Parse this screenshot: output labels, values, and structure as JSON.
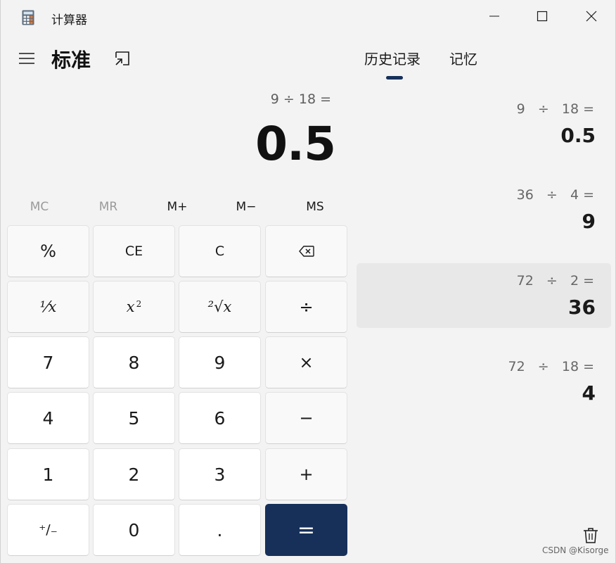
{
  "window": {
    "title": "计算器",
    "icon": "calculator-icon",
    "controls": [
      "minimize-icon",
      "maximize-icon",
      "close-icon"
    ]
  },
  "header": {
    "mode_title": "标准",
    "menu_icon": "hamburger-menu-icon",
    "keep_on_top_icon": "keep-on-top-icon"
  },
  "tabs": [
    {
      "label": "历史记录",
      "active": true
    },
    {
      "label": "记忆",
      "active": false
    }
  ],
  "display": {
    "expression": "9 ÷ 18 =",
    "result": "0.5"
  },
  "memory": [
    {
      "label": "MC",
      "enabled": false
    },
    {
      "label": "MR",
      "enabled": false
    },
    {
      "label": "M+",
      "enabled": true
    },
    {
      "label": "M−",
      "enabled": true
    },
    {
      "label": "MS",
      "enabled": true
    }
  ],
  "keypad": {
    "percent": "%",
    "ce": "CE",
    "c": "C",
    "backspace_icon": "backspace-icon",
    "reciprocal": "⅟x",
    "square_base": "x",
    "square_exp": "2",
    "sqrt": "²√x",
    "divide": "÷",
    "seven": "7",
    "eight": "8",
    "nine": "9",
    "multiply": "×",
    "four": "4",
    "five": "5",
    "six": "6",
    "minus": "−",
    "one": "1",
    "two": "2",
    "three": "3",
    "plus": "+",
    "negate": "⁺∕₋",
    "zero": "0",
    "decimal": ".",
    "equals": "="
  },
  "history": [
    {
      "expression": "9   ÷   18 =",
      "result": "0.5",
      "highlighted": false
    },
    {
      "expression": "36   ÷   4 =",
      "result": "9",
      "highlighted": false
    },
    {
      "expression": "72   ÷   2 =",
      "result": "36",
      "highlighted": true
    },
    {
      "expression": "72   ÷   18 =",
      "result": "4",
      "highlighted": false
    }
  ],
  "history_delete_icon": "trash-icon",
  "watermark": "CSDN @Kisorge",
  "colors": {
    "accent": "#16305a",
    "background": "#f3f3f3",
    "highlight": "#e8e8e8"
  }
}
